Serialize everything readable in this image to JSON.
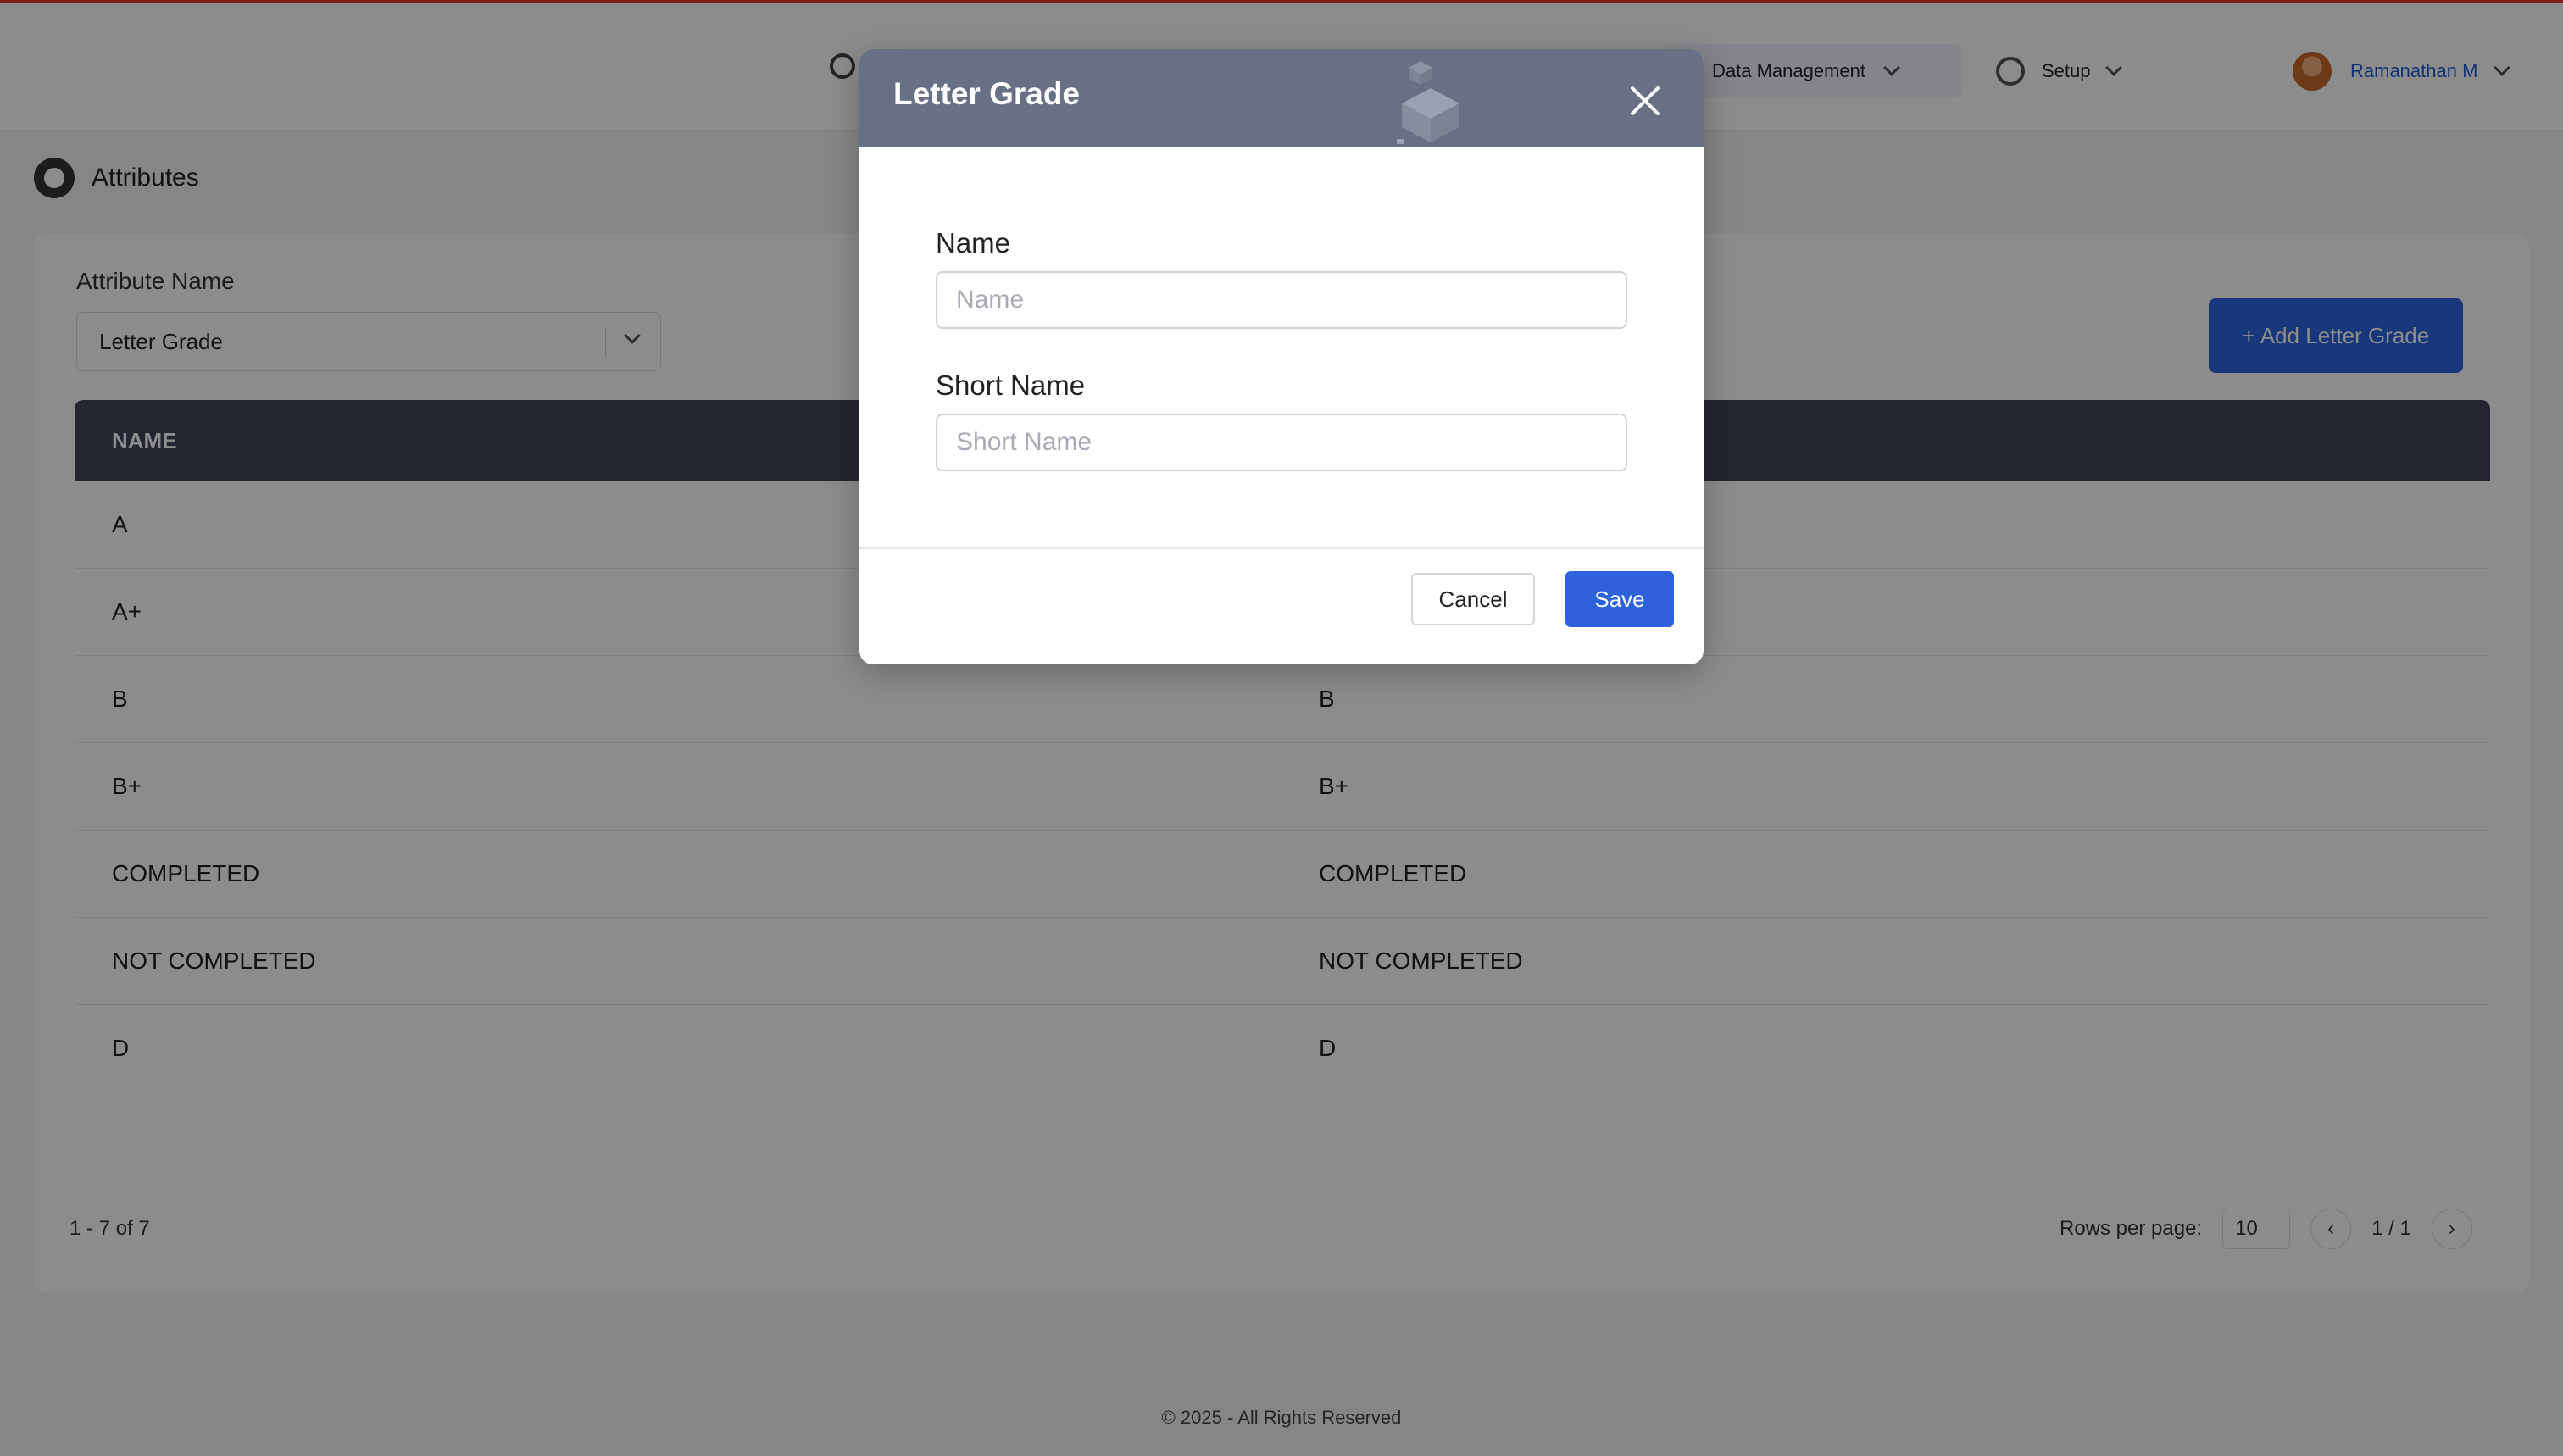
{
  "app": {
    "accent_color": "#e53935",
    "primary_color": "#2f64e0"
  },
  "navbar": {
    "search_icon": "search-icon",
    "data_management_label": "Data Management",
    "setup_label": "Setup",
    "user_name": "Ramanathan M"
  },
  "page": {
    "title": "Attributes",
    "attribute_label": "Attribute Name",
    "attribute_selected": "Letter Grade",
    "add_button_label": "+  Add Letter Grade"
  },
  "table": {
    "headers": [
      "NAME",
      ""
    ],
    "rows": [
      [
        "A",
        ""
      ],
      [
        "A+",
        ""
      ],
      [
        "B",
        "B"
      ],
      [
        "B+",
        "B+"
      ],
      [
        "COMPLETED",
        "COMPLETED"
      ],
      [
        "NOT COMPLETED",
        "NOT COMPLETED"
      ],
      [
        "D",
        "D"
      ]
    ]
  },
  "pagination": {
    "range_text": "1 - 7 of 7",
    "rows_per_page_label": "Rows per page:",
    "rows_per_page_value": "10",
    "page_text": "1 / 1"
  },
  "footer": {
    "text": "© 2025 - All Rights Reserved"
  },
  "modal": {
    "title": "Letter Grade",
    "name_label": "Name",
    "name_placeholder": "Name",
    "name_value": "",
    "short_name_label": "Short Name",
    "short_name_placeholder": "Short Name",
    "short_name_value": "",
    "cancel_label": "Cancel",
    "save_label": "Save",
    "header_color": "#677085",
    "save_color": "#2e62dd"
  }
}
